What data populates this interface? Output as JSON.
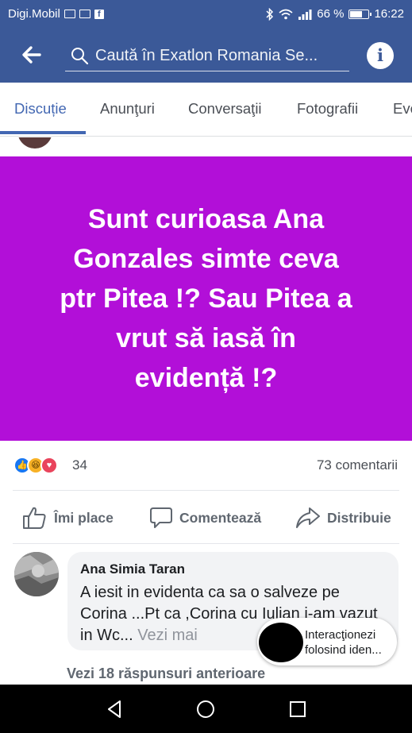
{
  "status_bar": {
    "carrier": "Digi.Mobil",
    "signal": ".ıll",
    "battery_percent": "66 %",
    "time": "16:22"
  },
  "header": {
    "search_placeholder": "Caută în Exatlon Romania Se...",
    "info_label": "i"
  },
  "tabs": [
    {
      "label": "Discuție",
      "active": true
    },
    {
      "label": "Anunţuri",
      "active": false
    },
    {
      "label": "Conversaţii",
      "active": false
    },
    {
      "label": "Fotografii",
      "active": false
    },
    {
      "label": "Eve",
      "active": false
    }
  ],
  "post": {
    "text": "Sunt curioasa   Ana\nGonzales simte ceva\nptr Pitea !? Sau Pitea a\nvrut să iasă în\nevidență !?",
    "background_color": "#b20fd8"
  },
  "reactions": {
    "count": "34",
    "comments": "73 comentarii",
    "icons": [
      "like-reaction-icon",
      "haha-reaction-icon",
      "love-reaction-icon"
    ]
  },
  "actions": {
    "like": "Îmi place",
    "comment": "Comentează",
    "share": "Distribuie"
  },
  "comment": {
    "author": "Ana Simia Taran",
    "text": "A iesit in evidenta ca sa o salveze pe Corina ...Pt ca ,Corina cu Iulian i-am vazut in Wc...",
    "see_more": "Vezi mai"
  },
  "see_more_replies": "Vezi 18 răspunsuri anterioare",
  "floating_pill": {
    "text_line1": "Interacţionezi",
    "text_line2": "folosind iden..."
  },
  "colors": {
    "brand": "#3b5998",
    "accent": "#4267b2",
    "post_bg": "#b20fd8"
  }
}
